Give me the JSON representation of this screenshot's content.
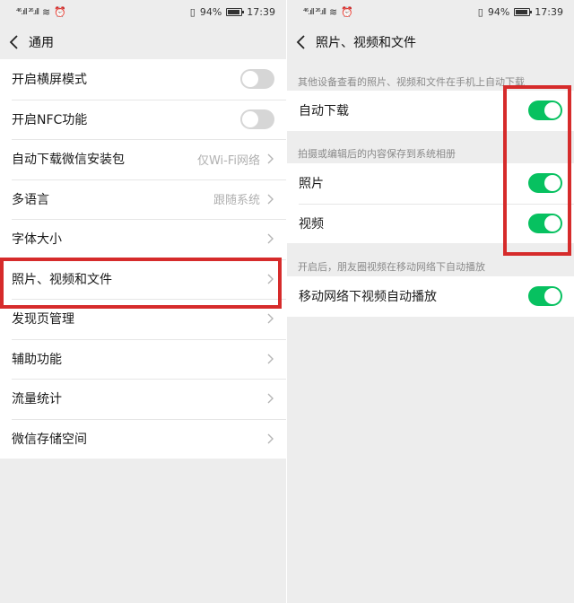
{
  "status_bar": {
    "signal_left": "⁴⁶.ıll ²⁶.ıll",
    "battery_percent": "94%",
    "time": "17:39"
  },
  "left_screen": {
    "title": "通用",
    "items": [
      {
        "label": "开启横屏模式",
        "kind": "toggle",
        "on": false
      },
      {
        "label": "开启NFC功能",
        "kind": "toggle",
        "on": false
      },
      {
        "label": "自动下载微信安装包",
        "kind": "value",
        "value": "仅Wi-Fi网络"
      },
      {
        "label": "多语言",
        "kind": "value",
        "value": "跟随系统"
      },
      {
        "label": "字体大小",
        "kind": "link"
      },
      {
        "label": "照片、视频和文件",
        "kind": "link"
      },
      {
        "label": "发现页管理",
        "kind": "link"
      },
      {
        "label": "辅助功能",
        "kind": "link"
      },
      {
        "label": "流量统计",
        "kind": "link"
      },
      {
        "label": "微信存储空间",
        "kind": "link"
      }
    ]
  },
  "right_screen": {
    "title": "照片、视频和文件",
    "sections": [
      {
        "header": "其他设备查看的照片、视频和文件在手机上自动下载",
        "items": [
          {
            "label": "自动下载",
            "on": true
          }
        ]
      },
      {
        "header": "拍摄或编辑后的内容保存到系统相册",
        "items": [
          {
            "label": "照片",
            "on": true
          },
          {
            "label": "视频",
            "on": true
          }
        ]
      },
      {
        "header": "开启后，朋友圈视频在移动网络下自动播放",
        "items": [
          {
            "label": "移动网络下视频自动播放",
            "on": true
          }
        ]
      }
    ]
  },
  "colors": {
    "toggle_on": "#07c160",
    "toggle_off": "#d6d6d6",
    "highlight": "#d62b2b",
    "background": "#ededed"
  }
}
